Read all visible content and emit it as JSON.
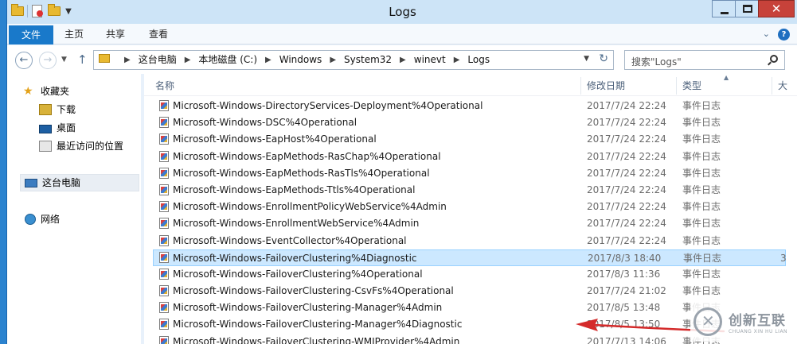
{
  "window": {
    "title": "Logs"
  },
  "ribbon": {
    "tabs": [
      {
        "label": "文件"
      },
      {
        "label": "主页"
      },
      {
        "label": "共享"
      },
      {
        "label": "查看"
      }
    ]
  },
  "address": {
    "crumbs": [
      "这台电脑",
      "本地磁盘 (C:)",
      "Windows",
      "System32",
      "winevt",
      "Logs"
    ]
  },
  "search": {
    "placeholder": "搜索\"Logs\""
  },
  "navpane": {
    "favorites": "收藏夹",
    "downloads": "下载",
    "desktop": "桌面",
    "recent": "最近访问的位置",
    "thispc": "这台电脑",
    "network": "网络"
  },
  "columns": {
    "name": "名称",
    "date": "修改日期",
    "type": "类型",
    "size": "大"
  },
  "files": [
    {
      "name": "Microsoft-Windows-DirectoryServices-Deployment%4Operational",
      "date": "2017/7/24 22:24",
      "type": "事件日志",
      "size": ""
    },
    {
      "name": "Microsoft-Windows-DSC%4Operational",
      "date": "2017/7/24 22:24",
      "type": "事件日志",
      "size": ""
    },
    {
      "name": "Microsoft-Windows-EapHost%4Operational",
      "date": "2017/7/24 22:24",
      "type": "事件日志",
      "size": ""
    },
    {
      "name": "Microsoft-Windows-EapMethods-RasChap%4Operational",
      "date": "2017/7/24 22:24",
      "type": "事件日志",
      "size": ""
    },
    {
      "name": "Microsoft-Windows-EapMethods-RasTls%4Operational",
      "date": "2017/7/24 22:24",
      "type": "事件日志",
      "size": ""
    },
    {
      "name": "Microsoft-Windows-EapMethods-Ttls%4Operational",
      "date": "2017/7/24 22:24",
      "type": "事件日志",
      "size": ""
    },
    {
      "name": "Microsoft-Windows-EnrollmentPolicyWebService%4Admin",
      "date": "2017/7/24 22:24",
      "type": "事件日志",
      "size": ""
    },
    {
      "name": "Microsoft-Windows-EnrollmentWebService%4Admin",
      "date": "2017/7/24 22:24",
      "type": "事件日志",
      "size": ""
    },
    {
      "name": "Microsoft-Windows-EventCollector%4Operational",
      "date": "2017/7/24 22:24",
      "type": "事件日志",
      "size": ""
    },
    {
      "name": "Microsoft-Windows-FailoverClustering%4Diagnostic",
      "date": "2017/8/3 18:40",
      "type": "事件日志",
      "size": "3"
    },
    {
      "name": "Microsoft-Windows-FailoverClustering%4Operational",
      "date": "2017/8/3 11:36",
      "type": "事件日志",
      "size": ""
    },
    {
      "name": "Microsoft-Windows-FailoverClustering-CsvFs%4Operational",
      "date": "2017/7/24 21:02",
      "type": "事件日志",
      "size": ""
    },
    {
      "name": "Microsoft-Windows-FailoverClustering-Manager%4Admin",
      "date": "2017/8/5 13:48",
      "type": "事件日志",
      "size": ""
    },
    {
      "name": "Microsoft-Windows-FailoverClustering-Manager%4Diagnostic",
      "date": "2017/8/5 13:50",
      "type": "事件日志",
      "size": ""
    },
    {
      "name": "Microsoft-Windows-FailoverClustering-WMIProvider%4Admin",
      "date": "2017/7/13 14:06",
      "type": "事件日志",
      "size": ""
    }
  ],
  "watermark": {
    "main": "创新互联",
    "sub": "CHUANG XIN HU LIAN"
  },
  "colors": {
    "accent": "#1979ca",
    "selection": "#cce8ff",
    "annotation": "#d42a2a"
  }
}
